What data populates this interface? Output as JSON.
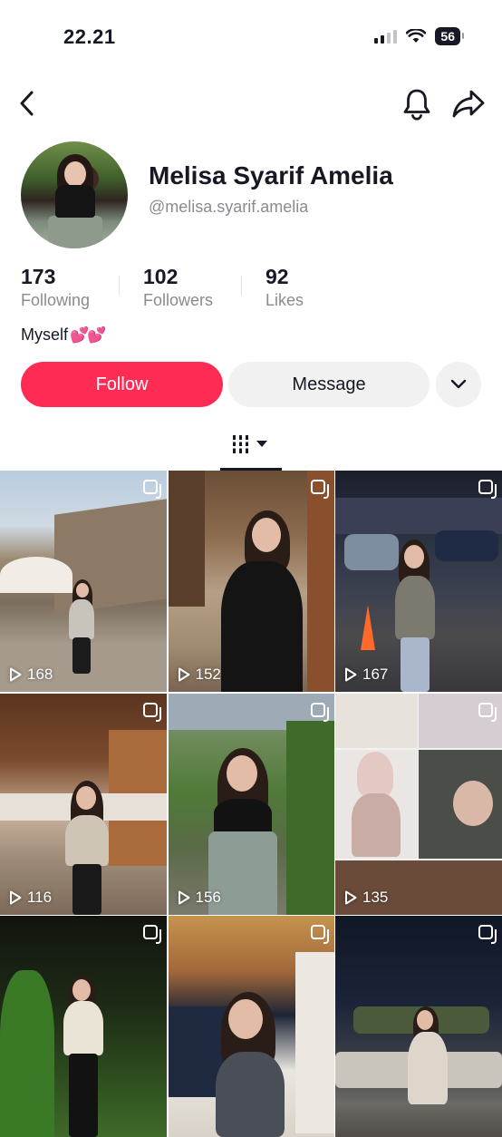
{
  "status_bar": {
    "time": "22.21",
    "battery": "56"
  },
  "profile": {
    "display_name": "Melisa Syarif Amelia",
    "username": "@melisa.syarif.amelia",
    "bio": "Myself",
    "bio_emoji": "💕💕"
  },
  "stats": [
    {
      "value": "173",
      "label": "Following"
    },
    {
      "value": "102",
      "label": "Followers"
    },
    {
      "value": "92",
      "label": "Likes"
    }
  ],
  "actions": {
    "follow_label": "Follow",
    "message_label": "Message"
  },
  "colors": {
    "accent": "#fe2c55",
    "secondary_button": "#f1f1f2",
    "muted_text": "#8a8b91"
  },
  "icons": [
    "back-icon",
    "bell-icon",
    "share-icon",
    "chevron-down-icon",
    "videos-grid-icon",
    "play-icon",
    "multi-photo-icon"
  ],
  "videos": [
    {
      "views": "168",
      "multi_photo": true
    },
    {
      "views": "152",
      "multi_photo": true
    },
    {
      "views": "167",
      "multi_photo": true
    },
    {
      "views": "116",
      "multi_photo": true
    },
    {
      "views": "156",
      "multi_photo": true
    },
    {
      "views": "135",
      "multi_photo": true
    },
    {
      "views": "",
      "multi_photo": true
    },
    {
      "views": "",
      "multi_photo": true
    },
    {
      "views": "",
      "multi_photo": true
    }
  ]
}
